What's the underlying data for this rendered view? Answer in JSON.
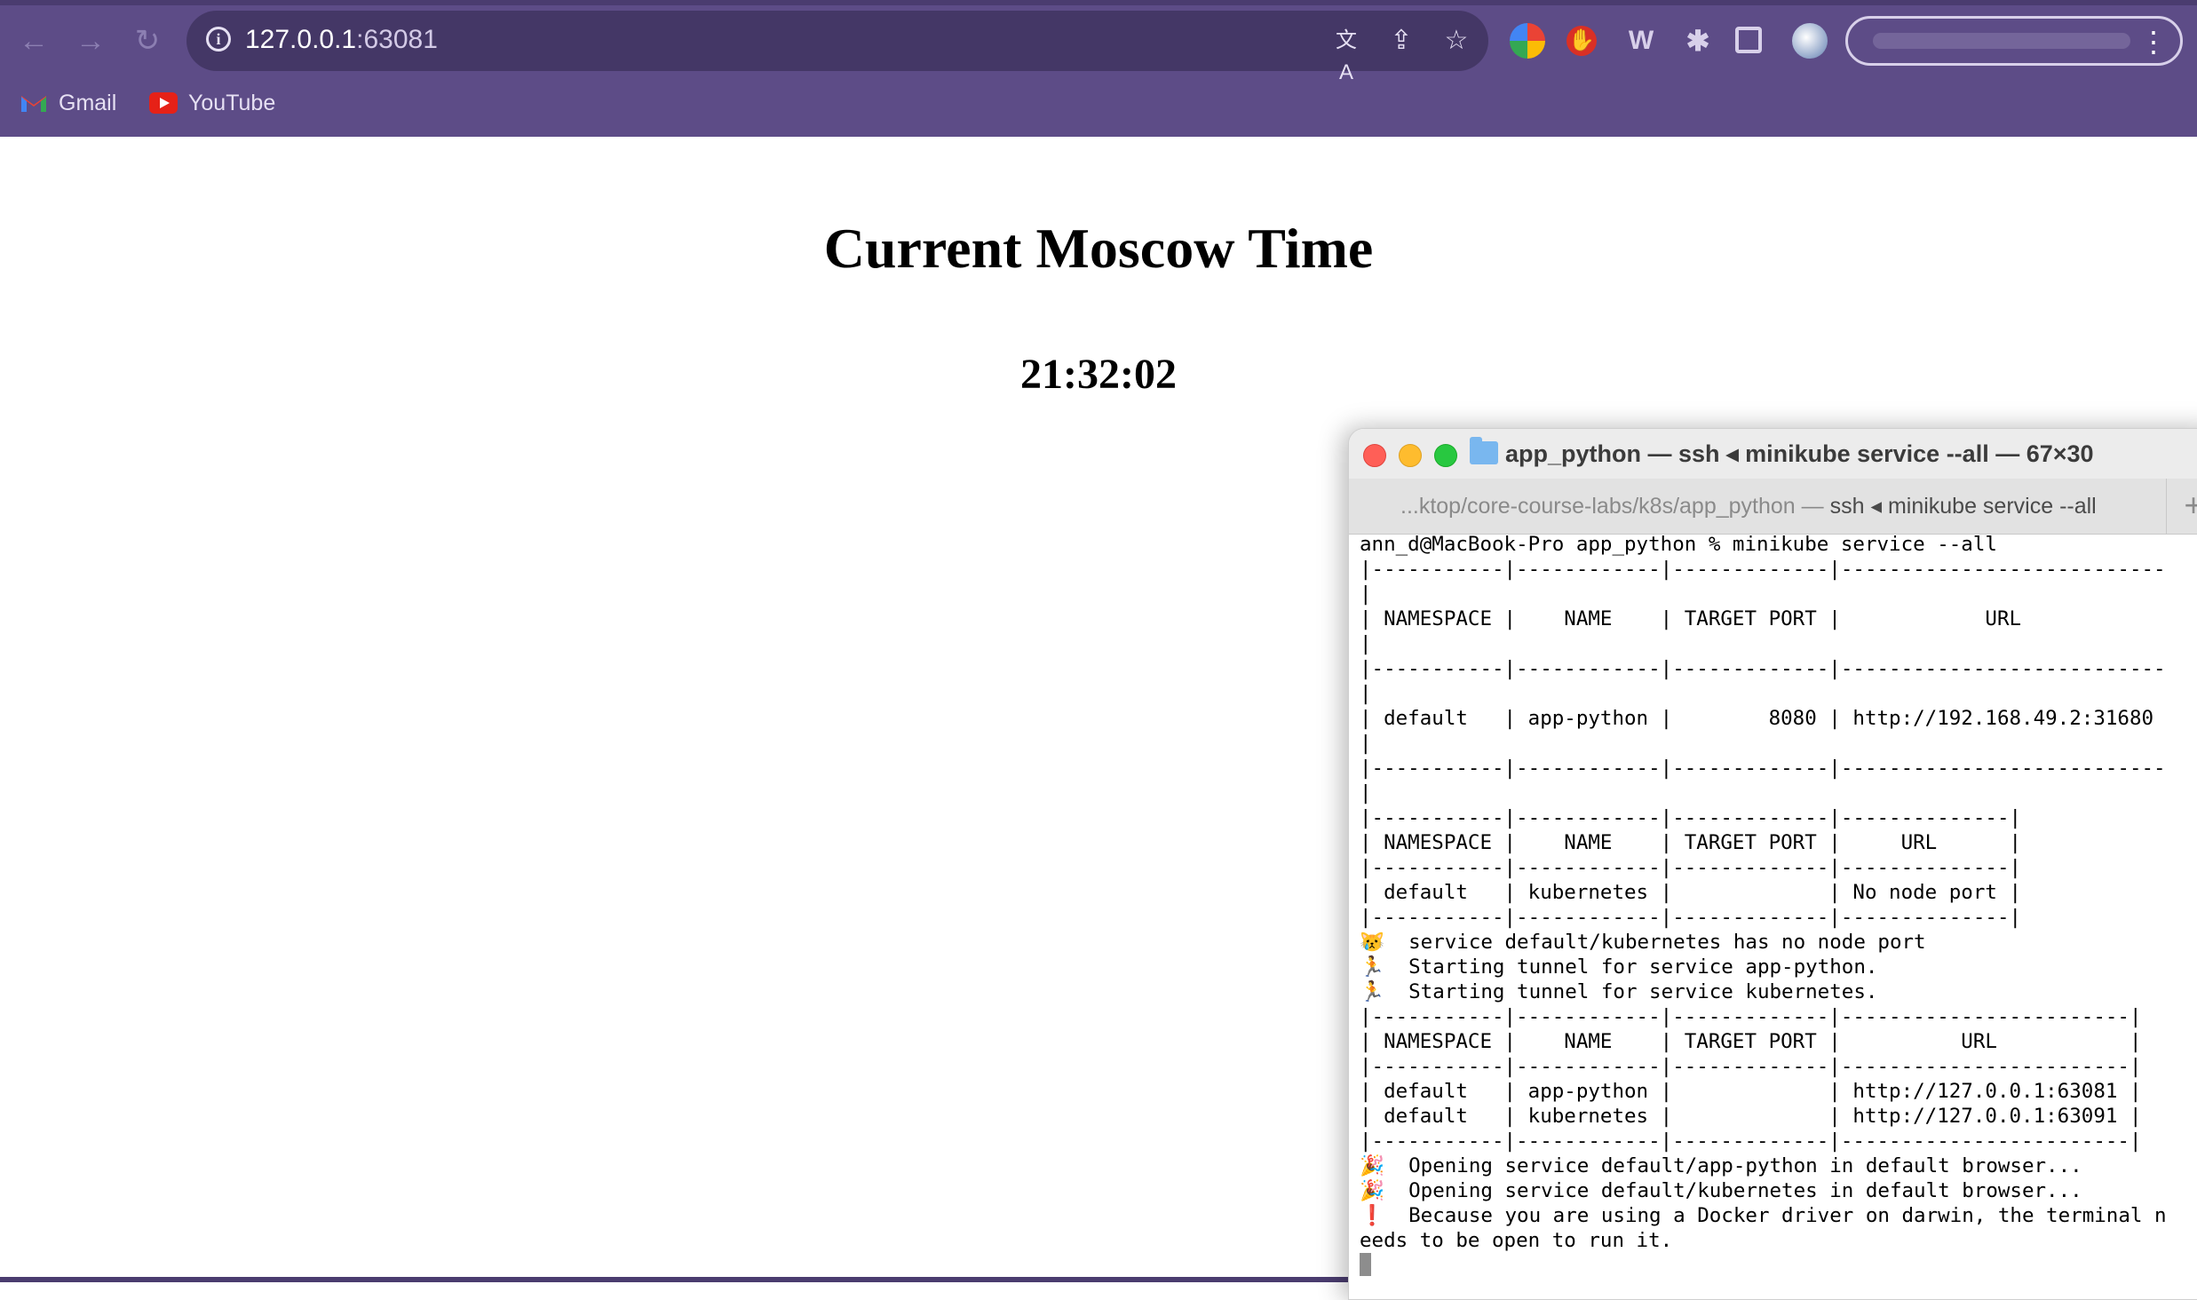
{
  "browser": {
    "url": "127.0.0.1",
    "url_port": ":63081",
    "bookmarks": [
      {
        "label": "Gmail",
        "icon": "gmail-icon"
      },
      {
        "label": "YouTube",
        "icon": "youtube-icon"
      }
    ],
    "colors": {
      "frame": "#5d4c87",
      "omnibox": "#443766"
    }
  },
  "page": {
    "title": "Current Moscow Time",
    "time": "21:32:02"
  },
  "terminal": {
    "title": "app_python — ssh ◂ minikube service --all — 67×30",
    "tab_label_dim": "...ktop/core-course-labs/k8s/app_python — ",
    "tab_label_rest": "ssh ◂ minikube service --all",
    "new_tab": "+",
    "lines": [
      "ann_d@MacBook-Pro app_python % minikube service --all",
      "|-----------|------------|-------------|---------------------------",
      "|",
      "| NAMESPACE |    NAME    | TARGET PORT |            URL",
      "|",
      "|-----------|------------|-------------|---------------------------",
      "|",
      "| default   | app-python |        8080 | http://192.168.49.2:31680",
      "|",
      "|-----------|------------|-------------|---------------------------",
      "|",
      "|-----------|------------|-------------|--------------|",
      "| NAMESPACE |    NAME    | TARGET PORT |     URL      |",
      "|-----------|------------|-------------|--------------|",
      "| default   | kubernetes |             | No node port |",
      "|-----------|------------|-------------|--------------|",
      "😿  service default/kubernetes has no node port",
      "🏃  Starting tunnel for service app-python.",
      "🏃  Starting tunnel for service kubernetes.",
      "|-----------|------------|-------------|------------------------|",
      "| NAMESPACE |    NAME    | TARGET PORT |          URL           |",
      "|-----------|------------|-------------|------------------------|",
      "| default   | app-python |             | http://127.0.0.1:63081 |",
      "| default   | kubernetes |             | http://127.0.0.1:63091 |",
      "|-----------|------------|-------------|------------------------|",
      "🎉  Opening service default/app-python in default browser...",
      "🎉  Opening service default/kubernetes in default browser...",
      "❗  Because you are using a Docker driver on darwin, the terminal n",
      "eeds to be open to run it."
    ]
  }
}
